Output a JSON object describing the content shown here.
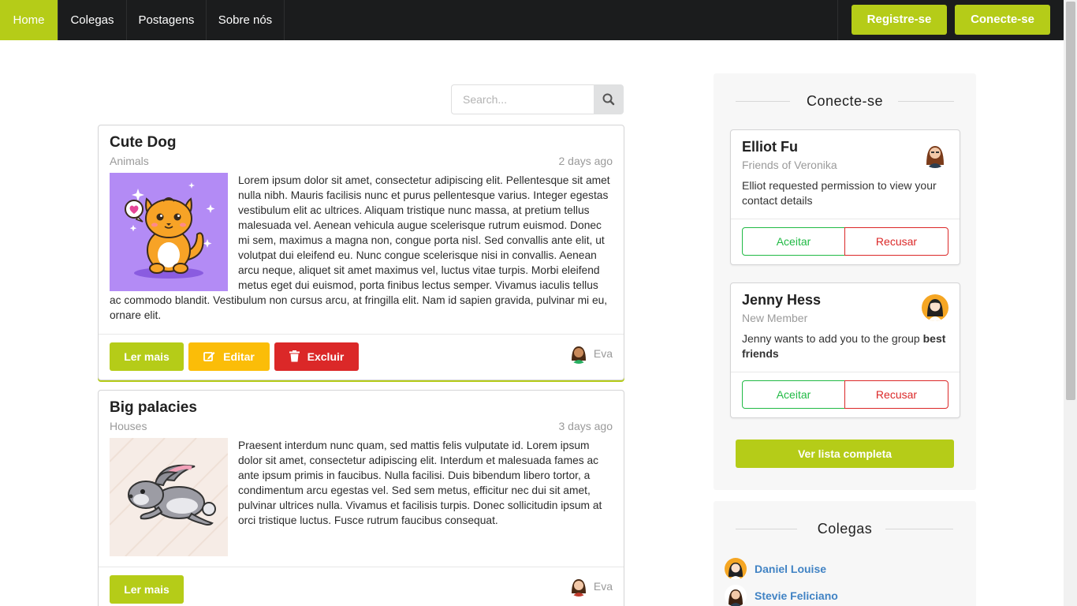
{
  "navbar": {
    "items": [
      {
        "label": "Home",
        "active": true
      },
      {
        "label": "Colegas",
        "active": false
      },
      {
        "label": "Postagens",
        "active": false
      },
      {
        "label": "Sobre nós",
        "active": false
      }
    ],
    "register_label": "Registre-se",
    "login_label": "Conecte-se"
  },
  "search": {
    "placeholder": "Search..."
  },
  "posts": [
    {
      "title": "Cute Dog",
      "category": "Animals",
      "time": "2 days ago",
      "image_icon": "cute-dog-illustration",
      "body": "Lorem ipsum dolor sit amet, consectetur adipiscing elit. Pellentesque sit amet nulla nibh. Mauris facilisis nunc et purus pellentesque varius. Integer egestas vestibulum elit ac ultrices. Aliquam tristique nunc massa, at pretium tellus malesuada vel. Aenean vehicula augue scelerisque rutrum euismod. Donec mi sem, maximus a magna non, congue porta nisl. Sed convallis ante elit, ut volutpat dui eleifend eu. Nunc congue scelerisque nisi in convallis. Aenean arcu neque, aliquet sit amet maximus vel, luctus vitae turpis. Morbi eleifend metus eget dui euismod, porta finibus lectus semper. Vivamus iaculis tellus ac commodo blandit. Vestibulum non cursus arcu, at fringilla elit. Nam id sapien gravida, pulvinar mi eu, ornare elit.",
      "read_more_label": "Ler mais",
      "edit_label": "Editar",
      "delete_label": "Excluir",
      "author": "Eva"
    },
    {
      "title": "Big palacies",
      "category": "Houses",
      "time": "3 days ago",
      "image_icon": "rabbit-illustration",
      "body": "Praesent interdum nunc quam, sed mattis felis vulputate id. Lorem ipsum dolor sit amet, consectetur adipiscing elit. Interdum et malesuada fames ac ante ipsum primis in faucibus. Nulla facilisi. Duis bibendum libero tortor, a condimentum arcu egestas vel. Sed sem metus, efficitur nec dui sit amet, pulvinar ultrices nulla. Vivamus et facilisis turpis. Donec sollicitudin ipsum at orci tristique luctus. Fusce rutrum faucibus consequat.",
      "read_more_label": "Ler mais",
      "author": "Eva"
    }
  ],
  "sidebar": {
    "connect_heading": "Conecte-se",
    "requests": [
      {
        "name": "Elliot Fu",
        "subtitle": "Friends of Veronika",
        "description": "Elliot requested permission to view your contact details",
        "accept_label": "Aceitar",
        "decline_label": "Recusar"
      },
      {
        "name": "Jenny Hess",
        "subtitle": "New Member",
        "description_prefix": "Jenny wants to add you to the group ",
        "description_bold": "best friends",
        "accept_label": "Aceitar",
        "decline_label": "Recusar"
      }
    ],
    "full_list_label": "Ver lista completa",
    "colleagues_heading": "Colegas",
    "colleagues": [
      {
        "name": "Daniel Louise"
      },
      {
        "name": "Stevie Feliciano"
      }
    ]
  },
  "colors": {
    "accent": "#b5cc18",
    "navbar": "#1b1c1d",
    "warning": "#fbbd08",
    "danger": "#db2828",
    "success": "#21ba45",
    "link": "#4183c4"
  }
}
